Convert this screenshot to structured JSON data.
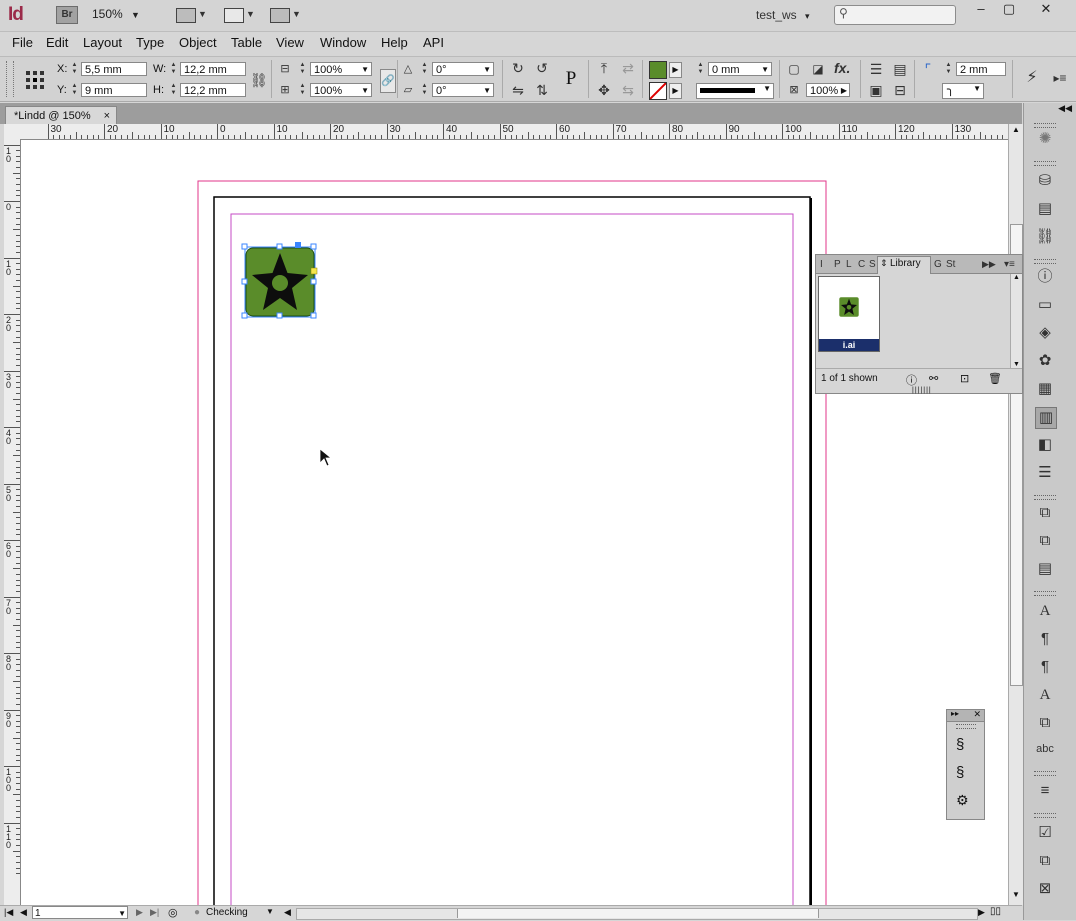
{
  "app": {
    "logo": "Id",
    "bridge": "Br",
    "zoom": "150%",
    "workspace": "test_ws",
    "window_controls": [
      "–",
      "▢",
      "✕"
    ]
  },
  "menu": [
    "File",
    "Edit",
    "Layout",
    "Type",
    "Object",
    "Table",
    "View",
    "Window",
    "Help",
    "API"
  ],
  "control": {
    "x_label": "X:",
    "x_value": "5,5 mm",
    "y_label": "Y:",
    "y_value": "9 mm",
    "w_label": "W:",
    "w_value": "12,2 mm",
    "h_label": "H:",
    "h_value": "12,2 mm",
    "scale_x": "100%",
    "scale_y": "100%",
    "rotate": "0°",
    "shear": "0°",
    "stroke_weight": "0 mm",
    "opacity": "100%",
    "corner_size": "2 mm",
    "fill_color": "#5a8c2a"
  },
  "document_tab": {
    "title": "*Lindd @ 150%",
    "close": "×"
  },
  "ruler": {
    "h_numbers": [
      "30",
      "20",
      "10",
      "0",
      "10",
      "20",
      "30",
      "40",
      "50",
      "60",
      "70",
      "80",
      "90",
      "100",
      "110",
      "120",
      "130"
    ],
    "v_numbers": [
      "10",
      "0",
      "10",
      "20",
      "30",
      "40",
      "50",
      "60",
      "70",
      "80",
      "90",
      "100",
      "110"
    ]
  },
  "library": {
    "tabs": [
      "I",
      "P",
      "L",
      "C",
      "S",
      "Library",
      "G",
      "St"
    ],
    "active_tab": "Library",
    "item_label": "i.ai",
    "count_text": "1 of 1 shown"
  },
  "status": {
    "page": "1",
    "preflight": "Checking"
  },
  "colors": {
    "margin": "#c54bc5",
    "bleed": "#e0358a",
    "selection": "#3a86ff",
    "icon_green": "#5a8c2a"
  }
}
